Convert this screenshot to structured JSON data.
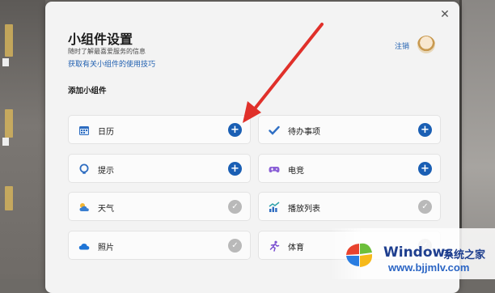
{
  "dialog": {
    "title": "小组件设置",
    "subtitle": "随时了解最喜爱服务的信息",
    "help_link": "获取有关小组件的使用技巧",
    "sign_out": "注销",
    "section": "添加小组件",
    "close_icon": "close-icon"
  },
  "widgets": [
    {
      "label": "日历",
      "icon": "calendar-icon",
      "state": "add"
    },
    {
      "label": "待办事项",
      "icon": "check-icon",
      "state": "add"
    },
    {
      "label": "提示",
      "icon": "tips-icon",
      "state": "add"
    },
    {
      "label": "电竞",
      "icon": "gamepad-icon",
      "state": "add"
    },
    {
      "label": "天气",
      "icon": "weather-icon",
      "state": "added"
    },
    {
      "label": "播放列表",
      "icon": "chart-icon",
      "state": "added"
    },
    {
      "label": "照片",
      "icon": "cloud-icon",
      "state": "added"
    },
    {
      "label": "体育",
      "icon": "runner-icon",
      "state": "added"
    }
  ],
  "watermark": {
    "brand": "Windows",
    "brand_cn": "系统之家",
    "url": "www.bjjmlv.com"
  },
  "colors": {
    "accent": "#1a5fb4",
    "annotation_arrow": "#e0302a"
  }
}
